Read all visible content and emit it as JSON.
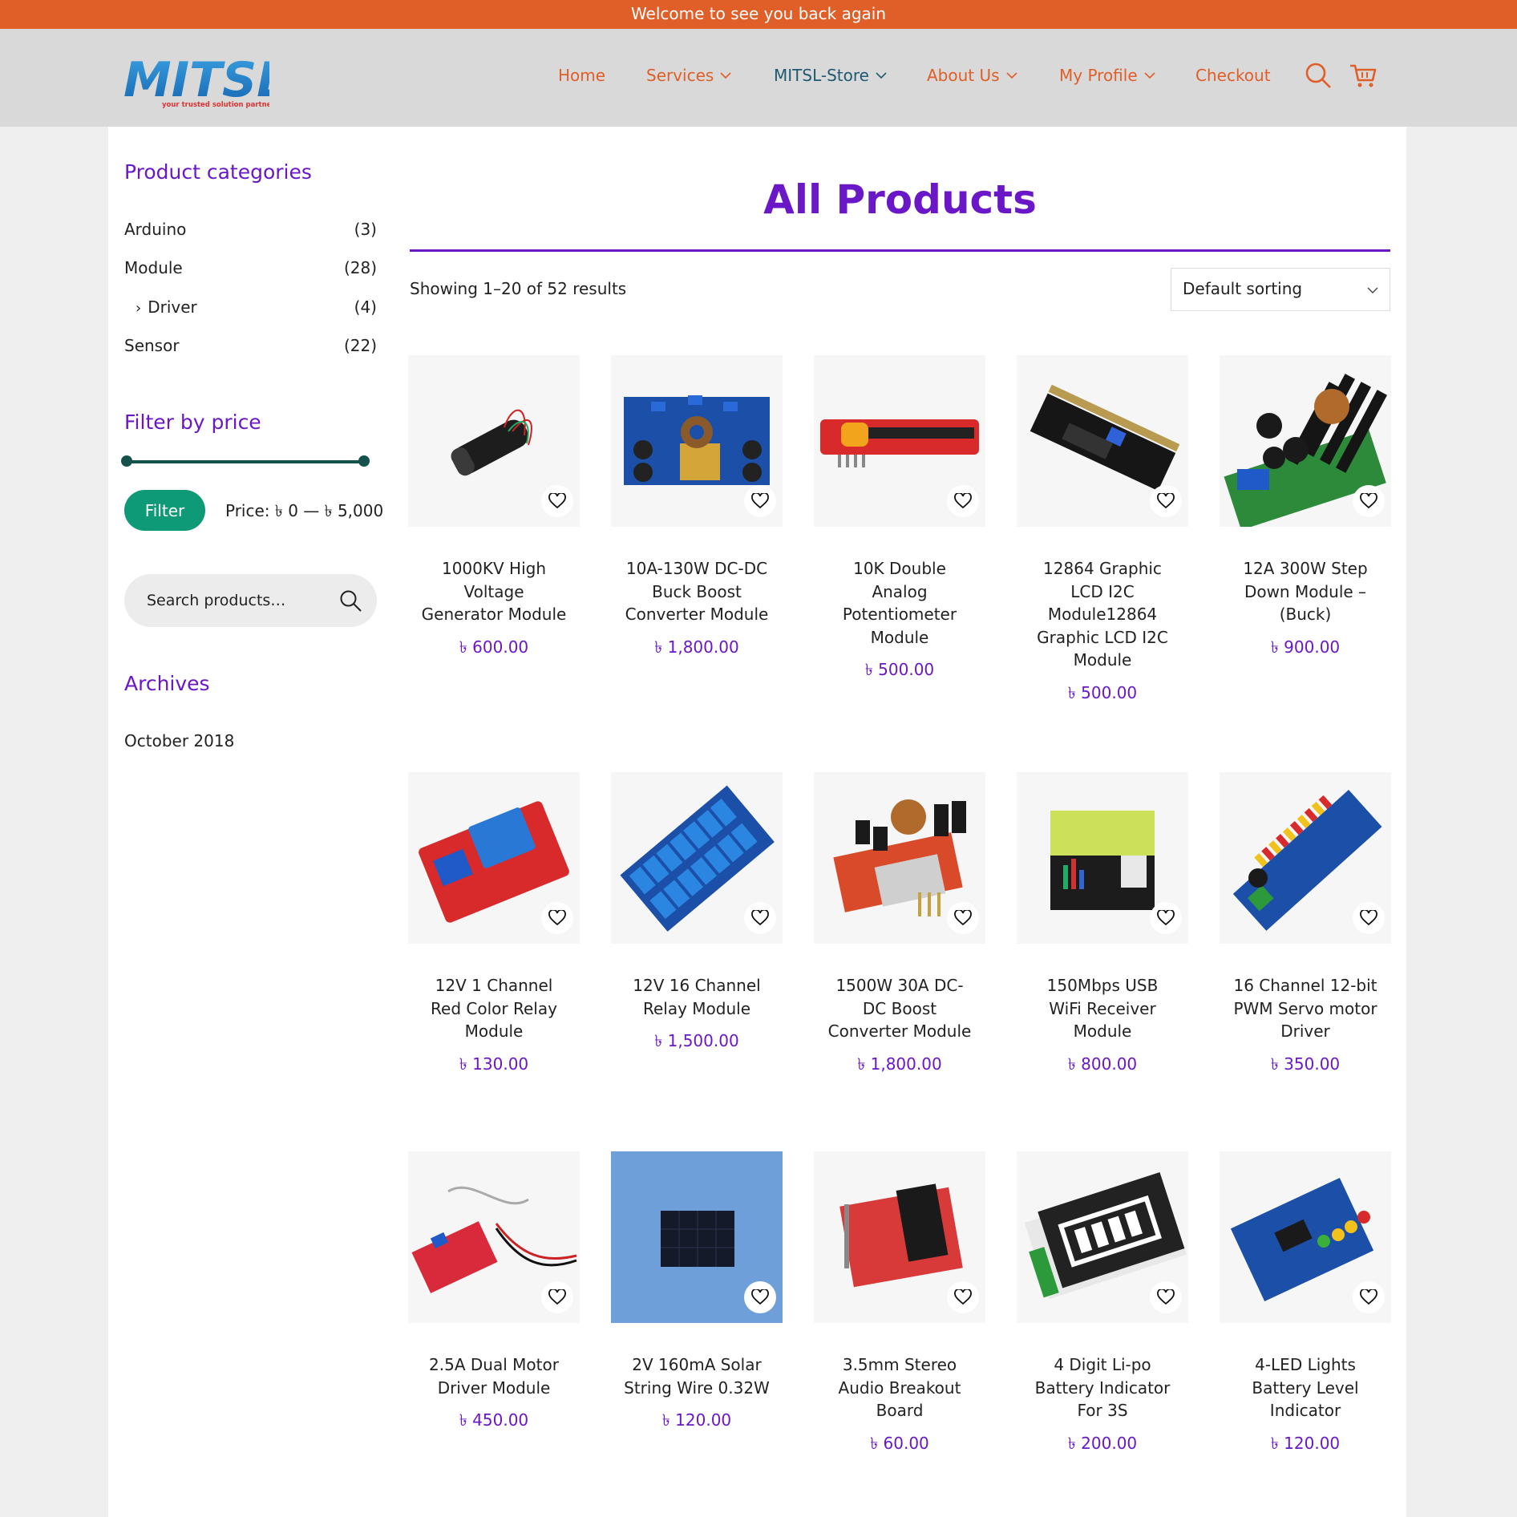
{
  "topbar": {
    "message": "Welcome to see you back again"
  },
  "header": {
    "logo_text": "MITSL",
    "logo_tagline": "your trusted solution partner",
    "nav": [
      {
        "label": "Home"
      },
      {
        "label": "Services"
      },
      {
        "label": "MITSL-Store"
      },
      {
        "label": "About Us"
      },
      {
        "label": "My Profile"
      },
      {
        "label": "Checkout"
      }
    ],
    "colors": {
      "accent": "#e05e28",
      "active": "#1f5a72"
    },
    "icons": [
      "search-icon",
      "cart-icon"
    ]
  },
  "sidebar": {
    "categories_title": "Product categories",
    "categories": [
      {
        "name": "Arduino",
        "count": "(3)"
      },
      {
        "name": "Module",
        "count": "(28)"
      },
      {
        "name": "Driver",
        "count": "(4)"
      },
      {
        "name": "Sensor",
        "count": "(22)"
      }
    ],
    "price_title": "Filter by price",
    "filter_label": "Filter",
    "price_range": "Price: ৳ 0 — ৳ 5,000",
    "search_placeholder": "Search products…",
    "archives_title": "Archives",
    "archives": [
      {
        "label": "October 2018"
      }
    ]
  },
  "main": {
    "title": "All Products",
    "result_count": "Showing 1–20 of 52 results",
    "sort_selected": "Default sorting",
    "products": [
      {
        "name": "1000KV High Voltage Generator Module",
        "price": "৳ 600.00"
      },
      {
        "name": "10A-130W DC-DC Buck Boost Converter Module",
        "price": "৳ 1,800.00"
      },
      {
        "name": "10K Double Analog Potentiometer Module",
        "price": "৳ 500.00"
      },
      {
        "name": "12864 Graphic LCD I2C Module12864 Graphic LCD I2C Module",
        "price": "৳ 500.00"
      },
      {
        "name": "12A 300W Step Down Module – (Buck)",
        "price": "৳ 900.00"
      },
      {
        "name": "12V 1 Channel Red Color Relay Module",
        "price": "৳ 130.00"
      },
      {
        "name": "12V 16 Channel Relay Module",
        "price": "৳ 1,500.00"
      },
      {
        "name": "1500W 30A DC-DC Boost Converter Module",
        "price": "৳ 1,800.00"
      },
      {
        "name": "150Mbps USB WiFi Receiver Module",
        "price": "৳ 800.00"
      },
      {
        "name": "16 Channel 12-bit PWM Servo motor Driver",
        "price": "৳ 350.00"
      },
      {
        "name": "2.5A Dual Motor Driver Module",
        "price": "৳ 450.00"
      },
      {
        "name": "2V 160mA Solar String Wire 0.32W",
        "price": "৳ 120.00"
      },
      {
        "name": "3.5mm Stereo Audio Breakout Board",
        "price": "৳ 60.00"
      },
      {
        "name": "4 Digit Li-po Battery Indicator For 3S",
        "price": "৳ 200.00"
      },
      {
        "name": "4-LED Lights Battery Level Indicator",
        "price": "৳ 120.00"
      }
    ],
    "colors": {
      "title": "#6a18c7",
      "filter_button": "#0e9a76",
      "slider": "#15524e"
    }
  }
}
